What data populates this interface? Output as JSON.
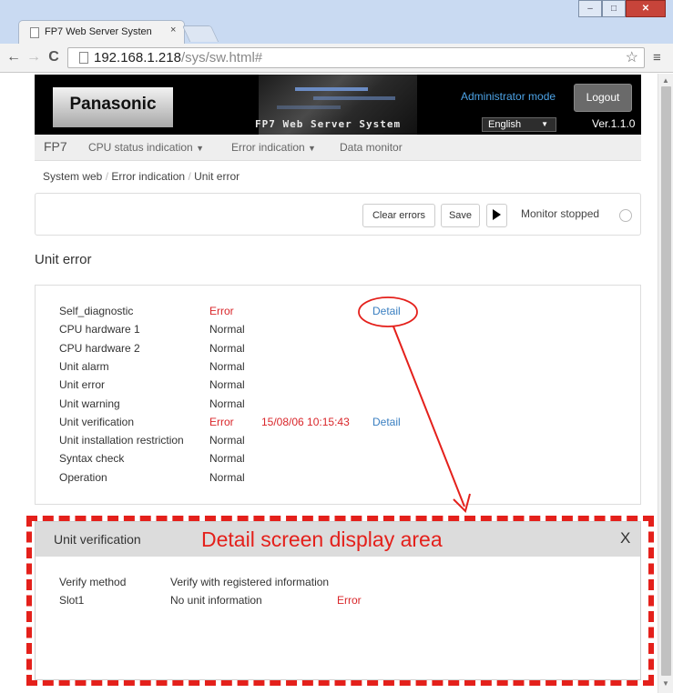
{
  "browser": {
    "tab_title": "FP7 Web Server Systen",
    "tab_close": "×",
    "url_host": "192.168.1.218",
    "url_path": "/sys/sw.html#"
  },
  "header": {
    "logo": "Panasonic",
    "system_title": "FP7 Web Server System",
    "admin_mode": "Administrator mode",
    "logout": "Logout",
    "language": "English",
    "version": "Ver.1.1.0"
  },
  "nav": {
    "brand": "FP7",
    "items": [
      "CPU status indication",
      "Error indication",
      "Data monitor"
    ]
  },
  "breadcrumb": [
    "System web",
    "Error indication",
    "Unit error"
  ],
  "controls": {
    "clear_errors": "Clear errors",
    "save": "Save",
    "monitor_status": "Monitor stopped"
  },
  "section_title": "Unit error",
  "status_rows": [
    {
      "name": "Self_diagnostic",
      "value": "Error",
      "time": "",
      "link": "Detail"
    },
    {
      "name": "CPU hardware 1",
      "value": "Normal",
      "time": "",
      "link": ""
    },
    {
      "name": "CPU hardware 2",
      "value": "Normal",
      "time": "",
      "link": ""
    },
    {
      "name": "Unit alarm",
      "value": "Normal",
      "time": "",
      "link": ""
    },
    {
      "name": "Unit error",
      "value": "Normal",
      "time": "",
      "link": ""
    },
    {
      "name": "Unit warning",
      "value": "Normal",
      "time": "",
      "link": ""
    },
    {
      "name": "Unit verification",
      "value": "Error",
      "time": "15/08/06 10:15:43",
      "link": "Detail"
    },
    {
      "name": "Unit installation restriction",
      "value": "Normal",
      "time": "",
      "link": ""
    },
    {
      "name": "Syntax check",
      "value": "Normal",
      "time": "",
      "link": ""
    },
    {
      "name": "Operation",
      "value": "Normal",
      "time": "",
      "link": ""
    }
  ],
  "detail": {
    "title": "Unit verification",
    "close": "X",
    "rows": [
      {
        "c1": "Verify method",
        "c2": "Verify with registered information",
        "c3": ""
      },
      {
        "c1": "Slot1",
        "c2": "No unit information",
        "c3": "Error"
      }
    ]
  },
  "annotation": {
    "label": "Detail screen display area",
    "color": "#e4201b"
  },
  "colors": {
    "error": "#d9262a",
    "link": "#3a7fc1",
    "admin_mode": "#4da3e6"
  }
}
